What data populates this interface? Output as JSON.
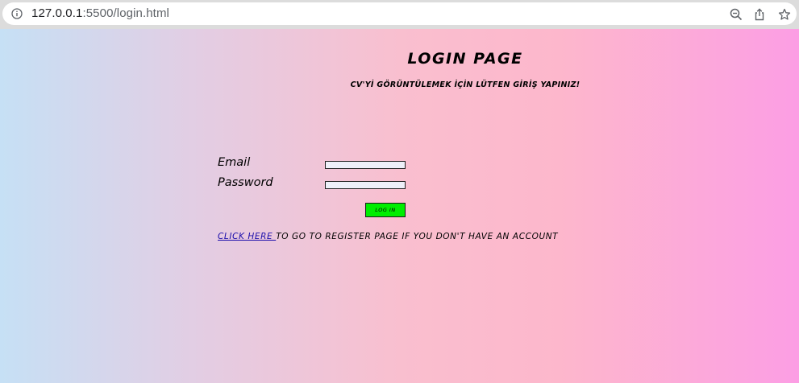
{
  "browser": {
    "url_host": "127.0.0.1",
    "url_rest": ":5500/login.html"
  },
  "page": {
    "title": "LOGIN PAGE",
    "subtitle": "CV'Yİ GÖRÜNTÜLEMEK İÇİN LÜTFEN GİRİŞ YAPINIZ!",
    "email_label": "Email",
    "password_label": "Password",
    "email_value": "",
    "password_value": "",
    "login_button": "LOG IN",
    "register_link": "CLICK HERE ",
    "register_text": "TO GO TO REGISTER PAGE IF YOU DON'T HAVE AN ACCOUNT"
  },
  "colors": {
    "button_bg": "#00ee00",
    "link": "#1a0dab"
  }
}
